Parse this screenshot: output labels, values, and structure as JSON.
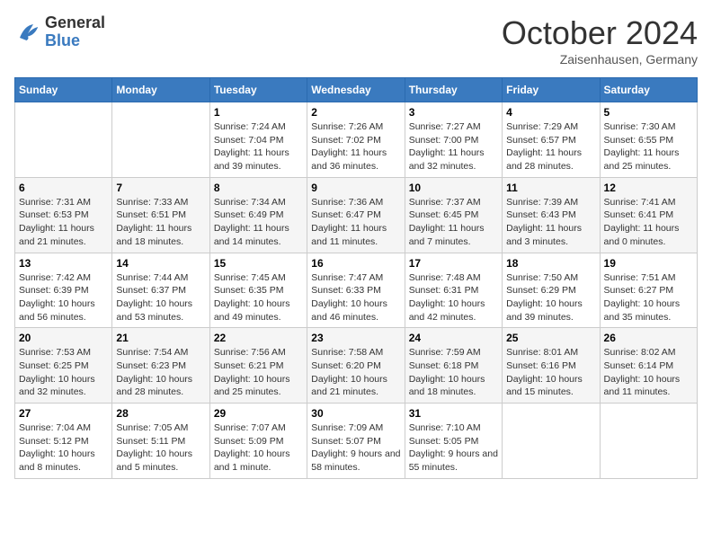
{
  "logo": {
    "general": "General",
    "blue": "Blue"
  },
  "header": {
    "title": "October 2024",
    "location": "Zaisenhausen, Germany"
  },
  "weekdays": [
    "Sunday",
    "Monday",
    "Tuesday",
    "Wednesday",
    "Thursday",
    "Friday",
    "Saturday"
  ],
  "weeks": [
    [
      {
        "day": null,
        "info": ""
      },
      {
        "day": null,
        "info": ""
      },
      {
        "day": "1",
        "sunrise": "Sunrise: 7:24 AM",
        "sunset": "Sunset: 7:04 PM",
        "daylight": "Daylight: 11 hours and 39 minutes."
      },
      {
        "day": "2",
        "sunrise": "Sunrise: 7:26 AM",
        "sunset": "Sunset: 7:02 PM",
        "daylight": "Daylight: 11 hours and 36 minutes."
      },
      {
        "day": "3",
        "sunrise": "Sunrise: 7:27 AM",
        "sunset": "Sunset: 7:00 PM",
        "daylight": "Daylight: 11 hours and 32 minutes."
      },
      {
        "day": "4",
        "sunrise": "Sunrise: 7:29 AM",
        "sunset": "Sunset: 6:57 PM",
        "daylight": "Daylight: 11 hours and 28 minutes."
      },
      {
        "day": "5",
        "sunrise": "Sunrise: 7:30 AM",
        "sunset": "Sunset: 6:55 PM",
        "daylight": "Daylight: 11 hours and 25 minutes."
      }
    ],
    [
      {
        "day": "6",
        "sunrise": "Sunrise: 7:31 AM",
        "sunset": "Sunset: 6:53 PM",
        "daylight": "Daylight: 11 hours and 21 minutes."
      },
      {
        "day": "7",
        "sunrise": "Sunrise: 7:33 AM",
        "sunset": "Sunset: 6:51 PM",
        "daylight": "Daylight: 11 hours and 18 minutes."
      },
      {
        "day": "8",
        "sunrise": "Sunrise: 7:34 AM",
        "sunset": "Sunset: 6:49 PM",
        "daylight": "Daylight: 11 hours and 14 minutes."
      },
      {
        "day": "9",
        "sunrise": "Sunrise: 7:36 AM",
        "sunset": "Sunset: 6:47 PM",
        "daylight": "Daylight: 11 hours and 11 minutes."
      },
      {
        "day": "10",
        "sunrise": "Sunrise: 7:37 AM",
        "sunset": "Sunset: 6:45 PM",
        "daylight": "Daylight: 11 hours and 7 minutes."
      },
      {
        "day": "11",
        "sunrise": "Sunrise: 7:39 AM",
        "sunset": "Sunset: 6:43 PM",
        "daylight": "Daylight: 11 hours and 3 minutes."
      },
      {
        "day": "12",
        "sunrise": "Sunrise: 7:41 AM",
        "sunset": "Sunset: 6:41 PM",
        "daylight": "Daylight: 11 hours and 0 minutes."
      }
    ],
    [
      {
        "day": "13",
        "sunrise": "Sunrise: 7:42 AM",
        "sunset": "Sunset: 6:39 PM",
        "daylight": "Daylight: 10 hours and 56 minutes."
      },
      {
        "day": "14",
        "sunrise": "Sunrise: 7:44 AM",
        "sunset": "Sunset: 6:37 PM",
        "daylight": "Daylight: 10 hours and 53 minutes."
      },
      {
        "day": "15",
        "sunrise": "Sunrise: 7:45 AM",
        "sunset": "Sunset: 6:35 PM",
        "daylight": "Daylight: 10 hours and 49 minutes."
      },
      {
        "day": "16",
        "sunrise": "Sunrise: 7:47 AM",
        "sunset": "Sunset: 6:33 PM",
        "daylight": "Daylight: 10 hours and 46 minutes."
      },
      {
        "day": "17",
        "sunrise": "Sunrise: 7:48 AM",
        "sunset": "Sunset: 6:31 PM",
        "daylight": "Daylight: 10 hours and 42 minutes."
      },
      {
        "day": "18",
        "sunrise": "Sunrise: 7:50 AM",
        "sunset": "Sunset: 6:29 PM",
        "daylight": "Daylight: 10 hours and 39 minutes."
      },
      {
        "day": "19",
        "sunrise": "Sunrise: 7:51 AM",
        "sunset": "Sunset: 6:27 PM",
        "daylight": "Daylight: 10 hours and 35 minutes."
      }
    ],
    [
      {
        "day": "20",
        "sunrise": "Sunrise: 7:53 AM",
        "sunset": "Sunset: 6:25 PM",
        "daylight": "Daylight: 10 hours and 32 minutes."
      },
      {
        "day": "21",
        "sunrise": "Sunrise: 7:54 AM",
        "sunset": "Sunset: 6:23 PM",
        "daylight": "Daylight: 10 hours and 28 minutes."
      },
      {
        "day": "22",
        "sunrise": "Sunrise: 7:56 AM",
        "sunset": "Sunset: 6:21 PM",
        "daylight": "Daylight: 10 hours and 25 minutes."
      },
      {
        "day": "23",
        "sunrise": "Sunrise: 7:58 AM",
        "sunset": "Sunset: 6:20 PM",
        "daylight": "Daylight: 10 hours and 21 minutes."
      },
      {
        "day": "24",
        "sunrise": "Sunrise: 7:59 AM",
        "sunset": "Sunset: 6:18 PM",
        "daylight": "Daylight: 10 hours and 18 minutes."
      },
      {
        "day": "25",
        "sunrise": "Sunrise: 8:01 AM",
        "sunset": "Sunset: 6:16 PM",
        "daylight": "Daylight: 10 hours and 15 minutes."
      },
      {
        "day": "26",
        "sunrise": "Sunrise: 8:02 AM",
        "sunset": "Sunset: 6:14 PM",
        "daylight": "Daylight: 10 hours and 11 minutes."
      }
    ],
    [
      {
        "day": "27",
        "sunrise": "Sunrise: 7:04 AM",
        "sunset": "Sunset: 5:12 PM",
        "daylight": "Daylight: 10 hours and 8 minutes."
      },
      {
        "day": "28",
        "sunrise": "Sunrise: 7:05 AM",
        "sunset": "Sunset: 5:11 PM",
        "daylight": "Daylight: 10 hours and 5 minutes."
      },
      {
        "day": "29",
        "sunrise": "Sunrise: 7:07 AM",
        "sunset": "Sunset: 5:09 PM",
        "daylight": "Daylight: 10 hours and 1 minute."
      },
      {
        "day": "30",
        "sunrise": "Sunrise: 7:09 AM",
        "sunset": "Sunset: 5:07 PM",
        "daylight": "Daylight: 9 hours and 58 minutes."
      },
      {
        "day": "31",
        "sunrise": "Sunrise: 7:10 AM",
        "sunset": "Sunset: 5:05 PM",
        "daylight": "Daylight: 9 hours and 55 minutes."
      },
      {
        "day": null,
        "info": ""
      },
      {
        "day": null,
        "info": ""
      }
    ]
  ]
}
